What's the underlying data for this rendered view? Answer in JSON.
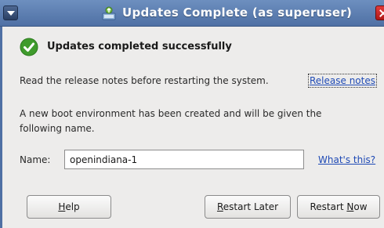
{
  "window": {
    "title": "Updates Complete (as superuser)",
    "title_icon": "update-manager-icon"
  },
  "header": {
    "icon": "checkmark-success-icon",
    "heading": "Updates completed successfully"
  },
  "release_notes": {
    "text": "Read the release notes before restarting the system.",
    "link": "Release notes"
  },
  "boot_env": {
    "line1": "A new boot environment has been created and will be given the",
    "line2": "following name."
  },
  "name_field": {
    "label": "Name:",
    "value": "openindiana-1",
    "help_link": "What's this?"
  },
  "buttons": {
    "help": {
      "mnemonic": "H",
      "rest": "elp"
    },
    "restart_later": {
      "mnemonic": "R",
      "rest": "estart Later"
    },
    "restart_now": {
      "prefix": "Restart ",
      "mnemonic": "N",
      "rest": "ow"
    }
  },
  "colors": {
    "titlebar": "#5a7cb0",
    "link": "#1f4ab5",
    "success_green": "#3f9b2c",
    "close_red": "#c62626"
  }
}
